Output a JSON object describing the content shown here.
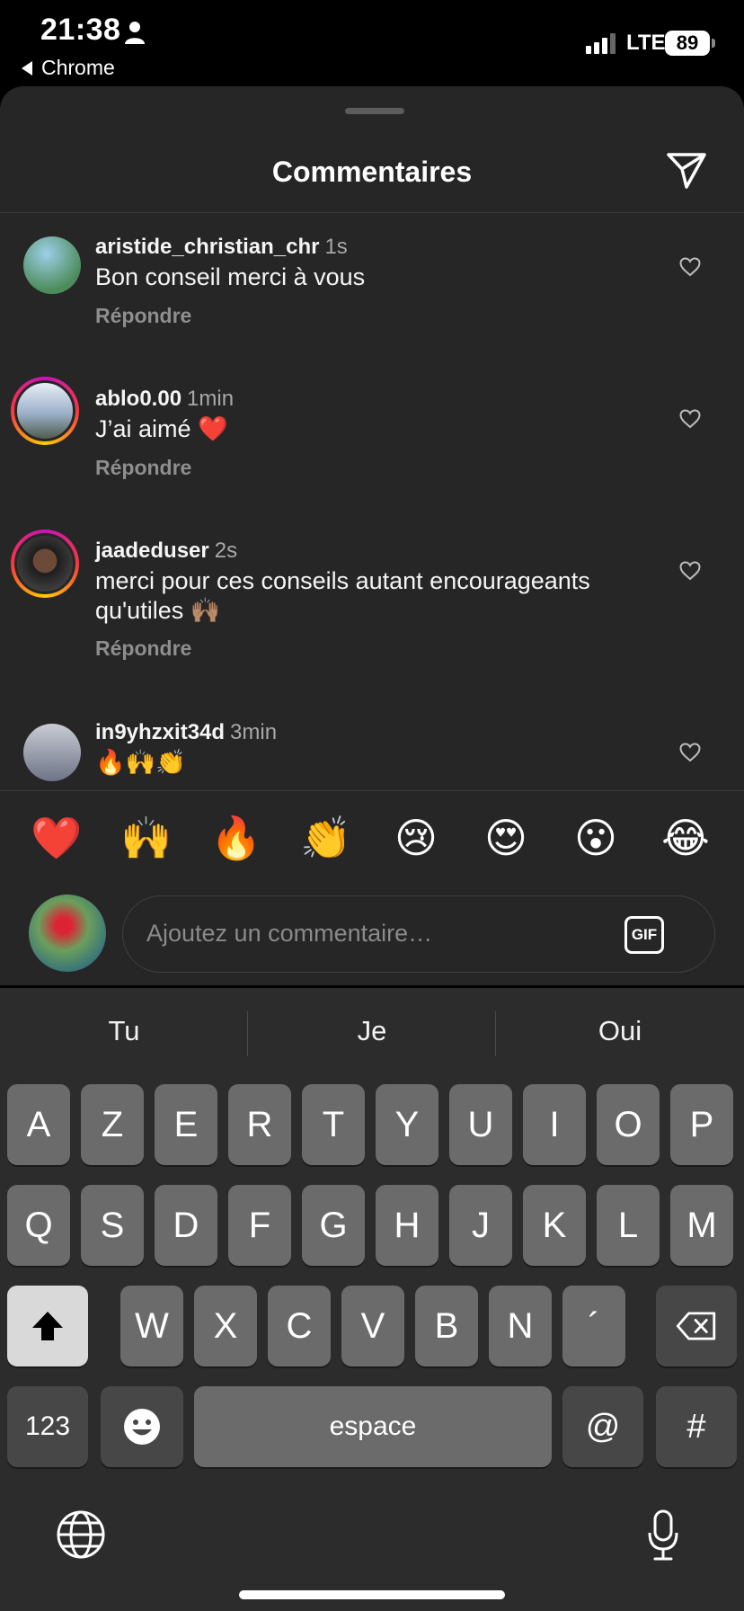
{
  "status_bar": {
    "time": "21:38",
    "back_app": "Chrome",
    "network": "LTE",
    "battery": "89"
  },
  "sheet": {
    "title": "Commentaires"
  },
  "comments": [
    {
      "username": "aristide_christian_chr",
      "time": "1s",
      "text": "Bon conseil merci à vous",
      "reply": "Répondre"
    },
    {
      "username": "ablo0.00",
      "time": "1min",
      "text": "J’ai aimé ❤️",
      "reply": "Répondre"
    },
    {
      "username": "jaadeduser",
      "time": "2s",
      "text": "merci pour ces conseils autant encourageants qu'utiles 🙌🏽",
      "reply": "Répondre"
    },
    {
      "username": "in9yhzxit34d",
      "time": "3min",
      "text": "🔥🙌👏",
      "reply": ""
    }
  ],
  "quick_emojis": [
    "❤️",
    "🙌",
    "🔥",
    "👏",
    "😢",
    "😍",
    "😮",
    "😂"
  ],
  "composer": {
    "placeholder": "Ajoutez un commentaire…",
    "gif_label": "GIF"
  },
  "keyboard": {
    "suggestions": [
      "Tu",
      "Je",
      "Oui"
    ],
    "row1": [
      "A",
      "Z",
      "E",
      "R",
      "T",
      "Y",
      "U",
      "I",
      "O",
      "P"
    ],
    "row2": [
      "Q",
      "S",
      "D",
      "F",
      "G",
      "H",
      "J",
      "K",
      "L",
      "M"
    ],
    "row3": [
      "W",
      "X",
      "C",
      "V",
      "B",
      "N",
      "´"
    ],
    "numbers_label": "123",
    "space_label": "espace",
    "at_label": "@",
    "hash_label": "#"
  }
}
